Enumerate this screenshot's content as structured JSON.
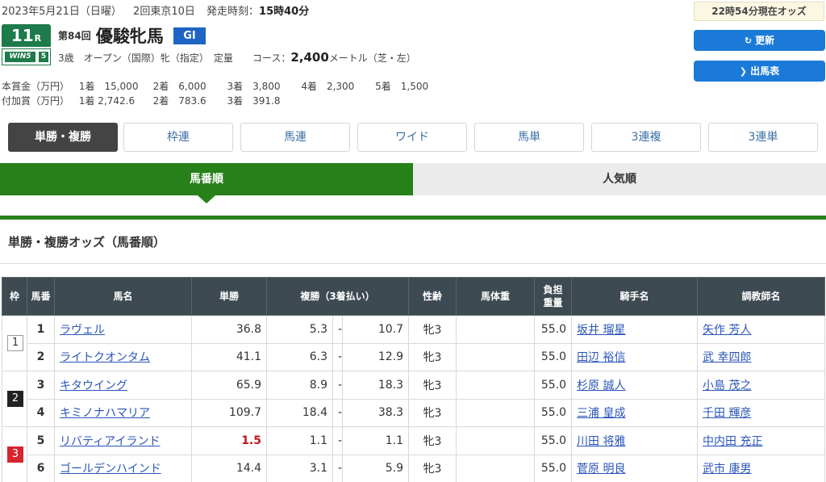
{
  "header": {
    "date_text": "2023年5月21日（日曜）",
    "meeting": "2回東京10日",
    "post_time_label": "発走時刻：",
    "post_time": "15時40分",
    "race_no": "11",
    "race_no_suffix": "R",
    "venue_badge": "WIN5",
    "venue_badge_no": "5",
    "edition": "第84回",
    "race_name": "優駿牝馬",
    "grade": "GI",
    "conditions": "3歳　オープン（国際）牝（指定）　定量　　コース：",
    "distance": "2,400",
    "distance_suffix": "メートル（芝・左）",
    "prize_main_label": "本賞金（万円）",
    "prize_main": [
      "1着　15,000",
      "2着　6,000",
      "3着　3,800",
      "4着　2,300",
      "5着　1,500"
    ],
    "prize_add_label": "付加賞（万円）",
    "prize_add": [
      "1着 2,742.6",
      "2着　783.6",
      "3着　391.8"
    ]
  },
  "side": {
    "odds_time": "22時54分現在オッズ",
    "refresh_label": "更新",
    "refresh_icon": "refresh-icon",
    "entries_label": "出馬表",
    "entries_icon": "circle-chevron-icon"
  },
  "bet_tabs": [
    "単勝・複勝",
    "枠連",
    "馬連",
    "ワイド",
    "馬単",
    "3連複",
    "3連単"
  ],
  "sort_tabs": {
    "active": "馬番順",
    "inactive": "人気順"
  },
  "section_title": "単勝・複勝オッズ（馬番順）",
  "table": {
    "headers": {
      "waku": "枠",
      "umaban": "馬番",
      "horse": "馬名",
      "win": "単勝",
      "place": "複勝（3着払い）",
      "sexage": "性齢",
      "weight": "馬体重",
      "burden_1": "負担",
      "burden_2": "重量",
      "jockey": "騎手名",
      "trainer": "調教師名"
    },
    "rows": [
      {
        "waku": "1",
        "umaban": "1",
        "horse": "ラヴェル",
        "win": "36.8",
        "place_lo": "5.3",
        "dash": "-",
        "place_hi": "10.7",
        "sexage": "牝3",
        "weight": "",
        "burden": "55.0",
        "jockey": "坂井 瑠星",
        "trainer": "矢作 芳人"
      },
      {
        "waku": "",
        "umaban": "2",
        "horse": "ライトクオンタム",
        "win": "41.1",
        "place_lo": "6.3",
        "dash": "-",
        "place_hi": "12.9",
        "sexage": "牝3",
        "weight": "",
        "burden": "55.0",
        "jockey": "田辺 裕信",
        "trainer": "武 幸四郎"
      },
      {
        "waku": "2",
        "umaban": "3",
        "horse": "キタウイング",
        "win": "65.9",
        "place_lo": "8.9",
        "dash": "-",
        "place_hi": "18.3",
        "sexage": "牝3",
        "weight": "",
        "burden": "55.0",
        "jockey": "杉原 誠人",
        "trainer": "小島 茂之"
      },
      {
        "waku": "",
        "umaban": "4",
        "horse": "キミノナハマリア",
        "win": "109.7",
        "place_lo": "18.4",
        "dash": "-",
        "place_hi": "38.3",
        "sexage": "牝3",
        "weight": "",
        "burden": "55.0",
        "jockey": "三浦 皇成",
        "trainer": "千田 輝彦"
      },
      {
        "waku": "3",
        "umaban": "5",
        "horse": "リバティアイランド",
        "win": "1.5",
        "place_lo": "1.1",
        "dash": "-",
        "place_hi": "1.1",
        "sexage": "牝3",
        "weight": "",
        "burden": "55.0",
        "jockey": "川田 将雅",
        "trainer": "中内田 充正"
      },
      {
        "waku": "",
        "umaban": "6",
        "horse": "ゴールデンハインド",
        "win": "14.4",
        "place_lo": "3.1",
        "dash": "-",
        "place_hi": "5.9",
        "sexage": "牝3",
        "weight": "",
        "burden": "55.0",
        "jockey": "菅原 明良",
        "trainer": "武市 康男"
      }
    ]
  },
  "colors": {
    "green": "#278019",
    "blue_button": "#1b7ad8",
    "header_dark": "#3d4a52",
    "favorite_red": "#c0161c"
  }
}
